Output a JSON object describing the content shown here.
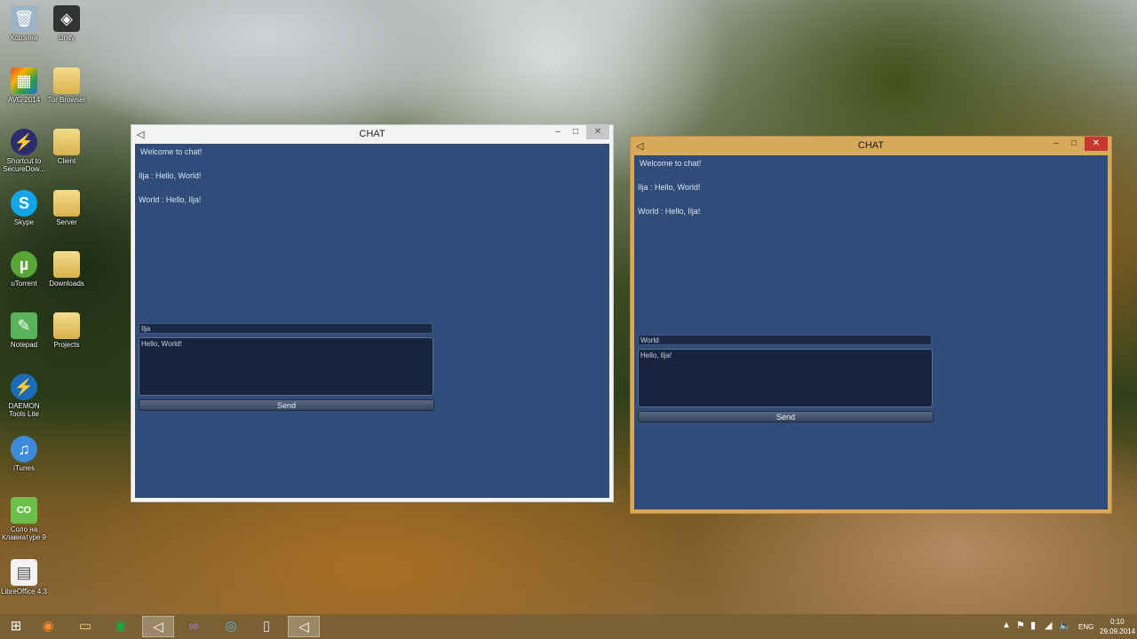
{
  "desktop": {
    "icons": [
      {
        "label": "Корзина",
        "icon": "recycle-bin-icon",
        "glyph": "🗑"
      },
      {
        "label": "Unity",
        "icon": "unity-icon",
        "glyph": "◈"
      },
      {
        "label": "AVG 2014",
        "icon": "avg-icon",
        "glyph": "▦"
      },
      {
        "label": "Tor Browser",
        "icon": "folder-icon",
        "glyph": ""
      },
      {
        "label": "Shortcut to SecureDow...",
        "icon": "lightning-icon",
        "glyph": "⚡"
      },
      {
        "label": "Client",
        "icon": "folder-icon",
        "glyph": ""
      },
      {
        "label": "Skype",
        "icon": "skype-icon",
        "glyph": "S"
      },
      {
        "label": "Server",
        "icon": "folder-icon",
        "glyph": ""
      },
      {
        "label": "uTorrent",
        "icon": "utorrent-icon",
        "glyph": "µ"
      },
      {
        "label": "Downloads",
        "icon": "folder-icon",
        "glyph": ""
      },
      {
        "label": "Notepad",
        "icon": "notepad-icon",
        "glyph": "✎"
      },
      {
        "label": "Projects",
        "icon": "folder-icon",
        "glyph": ""
      },
      {
        "label": "DAEMON Tools Lite",
        "icon": "daemon-tools-icon",
        "glyph": "⚡"
      },
      {
        "label": "iTunes",
        "icon": "itunes-icon",
        "glyph": "♫"
      },
      {
        "label": "Соло на Клавиатуре 9",
        "icon": "solo-icon",
        "glyph": "СО"
      },
      {
        "label": "LibreOffice 4.3",
        "icon": "libreoffice-icon",
        "glyph": "▤"
      }
    ]
  },
  "window_left": {
    "title": "CHAT",
    "controls": {
      "minimize": "–",
      "maximize": "□",
      "close": "✕"
    },
    "messages": [
      "Welcome to chat!",
      "Ilja : Hello, World!",
      "World : Hello, Ilja!"
    ],
    "name_value": "Ilja",
    "message_value": "Hello, World!",
    "send_label": "Send"
  },
  "window_right": {
    "title": "CHAT",
    "controls": {
      "minimize": "–",
      "maximize": "□",
      "close": "✕"
    },
    "messages": [
      "Welcome to chat!",
      "Ilja : Hello, World!",
      "World : Hello, Ilja!"
    ],
    "name_value": "World",
    "message_value": "Hello, Ilja!",
    "send_label": "Send"
  },
  "taskbar": {
    "items": [
      {
        "icon": "start-icon",
        "glyph": "⊞"
      },
      {
        "icon": "firefox-icon",
        "glyph": "◉"
      },
      {
        "icon": "file-explorer-icon",
        "glyph": "▭"
      },
      {
        "icon": "store-icon",
        "glyph": "▣"
      },
      {
        "icon": "unity-icon",
        "glyph": "◁"
      },
      {
        "icon": "visual-studio-icon",
        "glyph": "∞"
      },
      {
        "icon": "app-icon",
        "glyph": "◎"
      },
      {
        "icon": "window-icon",
        "glyph": "▯"
      },
      {
        "icon": "unity-icon",
        "glyph": "◁"
      }
    ],
    "tray": {
      "language": "ENG",
      "time": "0:10",
      "date": "29.09.2014"
    }
  }
}
